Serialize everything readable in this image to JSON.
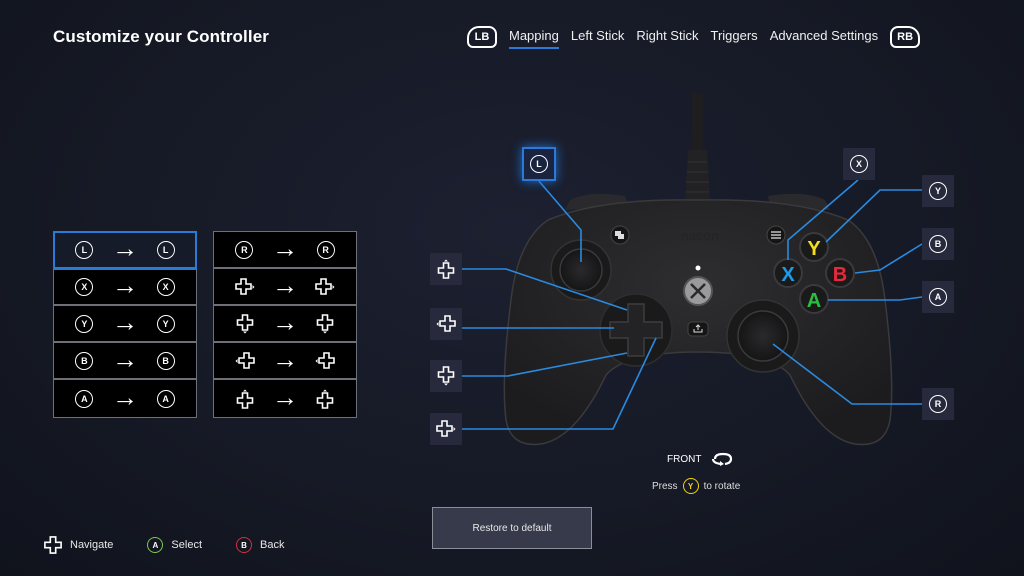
{
  "header": {
    "title": "Customize your Controller"
  },
  "tabs": {
    "left_bumper": "LB",
    "right_bumper": "RB",
    "items": [
      {
        "label": "Mapping",
        "active": true
      },
      {
        "label": "Left Stick",
        "active": false
      },
      {
        "label": "Right Stick",
        "active": false
      },
      {
        "label": "Triggers",
        "active": false
      },
      {
        "label": "Advanced Settings",
        "active": false
      }
    ]
  },
  "mapping": {
    "left_table": [
      {
        "from": "L",
        "to": "L",
        "icon": "left-stick-button",
        "selected": true
      },
      {
        "from": "X",
        "to": "X",
        "icon": "x-button",
        "selected": false
      },
      {
        "from": "Y",
        "to": "Y",
        "icon": "y-button",
        "selected": false
      },
      {
        "from": "B",
        "to": "B",
        "icon": "b-button",
        "selected": false
      },
      {
        "from": "A",
        "to": "A",
        "icon": "a-button",
        "selected": false
      }
    ],
    "right_table": [
      {
        "from": "R",
        "to": "R",
        "icon": "right-stick-button"
      },
      {
        "from": "dpad-right",
        "to": "dpad-right",
        "icon": "dpad-right-icon"
      },
      {
        "from": "dpad-down",
        "to": "dpad-down",
        "icon": "dpad-down-icon"
      },
      {
        "from": "dpad-left",
        "to": "dpad-left",
        "icon": "dpad-left-icon"
      },
      {
        "from": "dpad-up",
        "to": "dpad-up",
        "icon": "dpad-up-icon"
      }
    ],
    "arrow_glyph": "→"
  },
  "controller": {
    "callouts": {
      "left_stick": "L",
      "right_stick": "R",
      "x": "X",
      "y": "Y",
      "b": "B",
      "a": "A"
    },
    "face_buttons": {
      "x": {
        "label": "X",
        "color": "#1e9be8"
      },
      "y": {
        "label": "Y",
        "color": "#f2e01c"
      },
      "b": {
        "label": "B",
        "color": "#e8283c"
      },
      "a": {
        "label": "A",
        "color": "#28c040"
      }
    },
    "view_label": "FRONT",
    "rotate_hint_prefix": "Press",
    "rotate_hint_button": "Y",
    "rotate_hint_suffix": "to rotate"
  },
  "actions": {
    "restore_label": "Restore to default"
  },
  "footer": {
    "navigate_label": "Navigate",
    "select_button": "A",
    "select_label": "Select",
    "back_button": "B",
    "back_label": "Back"
  },
  "colors": {
    "accent": "#2a7ad8",
    "background": "#181c28"
  }
}
